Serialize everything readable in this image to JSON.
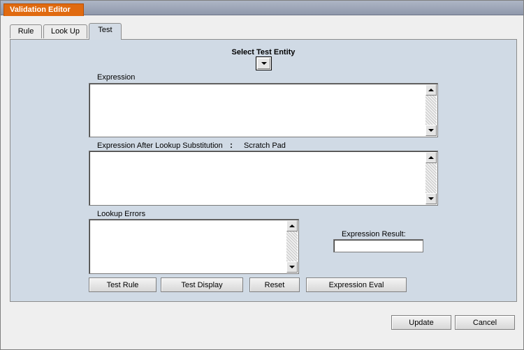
{
  "window": {
    "title": "Validation Editor"
  },
  "tabs": [
    {
      "label": "Rule",
      "active": false
    },
    {
      "label": "Look Up",
      "active": false
    },
    {
      "label": "Test",
      "active": true
    }
  ],
  "test_panel": {
    "select_entity_label": "Select Test Entity",
    "expression_label": "Expression",
    "expression_value": "",
    "after_lookup_label": "Expression After Lookup Substitution",
    "separator": ":",
    "scratch_pad_label": "Scratch Pad",
    "after_lookup_value": "",
    "lookup_errors_label": "Lookup Errors",
    "lookup_errors_value": "",
    "expression_result_label": "Expression Result:",
    "expression_result_value": "",
    "buttons": {
      "test_rule": "Test Rule",
      "test_display": "Test Display",
      "reset": "Reset",
      "expression_eval": "Expression Eval"
    }
  },
  "footer": {
    "update": "Update",
    "cancel": "Cancel"
  },
  "colors": {
    "title_accent": "#e06a10",
    "panel_background": "#d0dae5"
  }
}
